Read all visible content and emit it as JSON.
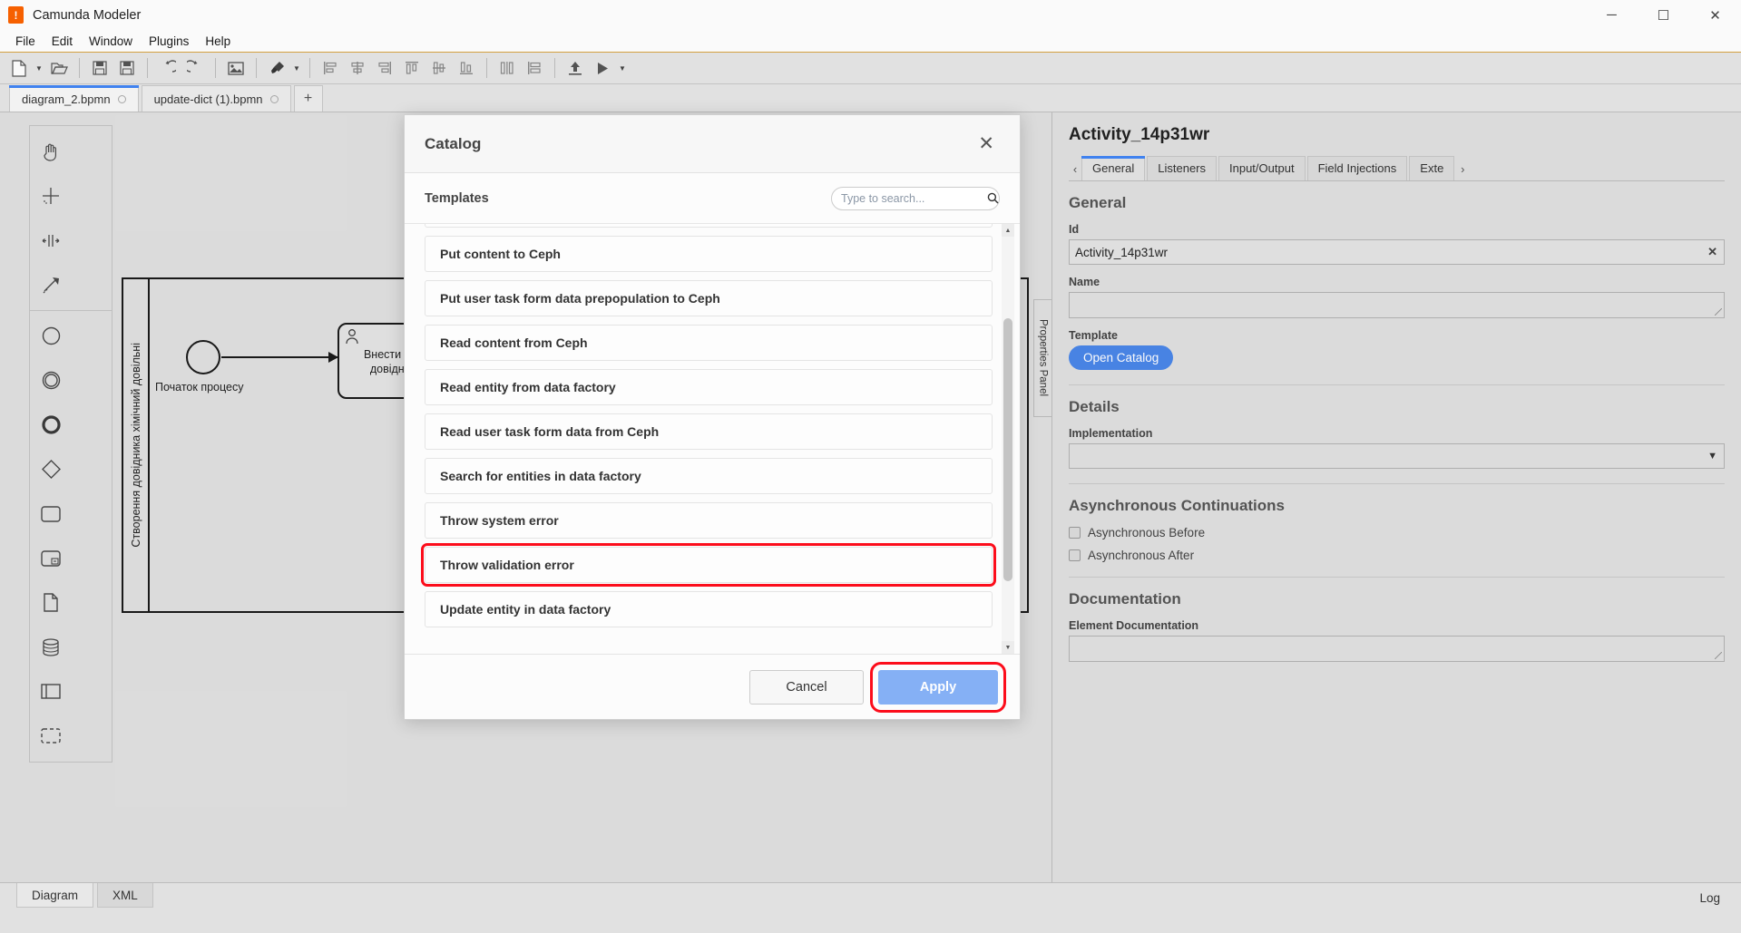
{
  "window": {
    "app_title": "Camunda Modeler",
    "logo_glyph": "!",
    "minimize": "─",
    "maximize": "☐",
    "close": "✕"
  },
  "menu": {
    "items": [
      "File",
      "Edit",
      "Window",
      "Plugins",
      "Help"
    ]
  },
  "toolbar": {
    "buttons": [
      {
        "name": "new-diagram-icon",
        "caret": true
      },
      {
        "name": "open-folder-icon",
        "caret": false
      },
      {
        "name": "save-icon",
        "caret": false
      },
      {
        "name": "save-as-icon",
        "caret": false
      },
      {
        "name": "undo-icon",
        "caret": false
      },
      {
        "name": "redo-icon",
        "caret": false
      },
      {
        "name": "export-image-icon",
        "caret": false
      },
      {
        "name": "align-tool-icon",
        "caret": true
      },
      {
        "name": "align-left-icon",
        "caret": false
      },
      {
        "name": "align-center-icon",
        "caret": false
      },
      {
        "name": "align-right-icon",
        "caret": false
      },
      {
        "name": "align-top-icon",
        "caret": false
      },
      {
        "name": "align-middle-icon",
        "caret": false
      },
      {
        "name": "align-bottom-icon",
        "caret": false
      },
      {
        "name": "distribute-horizontal-icon",
        "caret": false
      },
      {
        "name": "distribute-vertical-icon",
        "caret": false
      },
      {
        "name": "deploy-icon",
        "caret": false
      },
      {
        "name": "start-instance-icon",
        "caret": true
      }
    ]
  },
  "tabs": {
    "items": [
      {
        "label": "diagram_2.bpmn",
        "active": true
      },
      {
        "label": "update-dict (1).bpmn",
        "active": false
      }
    ],
    "add_label": "+"
  },
  "palette": {
    "rows": [
      [
        "hand-tool-icon",
        "lasso-tool-icon"
      ],
      [
        "space-tool-icon",
        "connect-tool-icon"
      ],
      [
        "start-event-icon",
        "intermediate-event-icon"
      ],
      [
        "end-event-icon",
        "gateway-icon"
      ],
      [
        "task-icon",
        "subprocess-icon"
      ],
      [
        "data-object-icon",
        "data-store-icon"
      ],
      [
        "participant-icon",
        "group-icon"
      ]
    ]
  },
  "canvas": {
    "pool_label": "Створення довідника хімічний довільні",
    "start_event_label": "Початок процесу",
    "task_line1": "Внести зап",
    "task_line2": "довідник",
    "properties_panel_tab": "Properties Panel"
  },
  "modal": {
    "title": "Catalog",
    "close_glyph": "✕",
    "section_title": "Templates",
    "search_placeholder": "Type to search...",
    "search_value": "",
    "search_icon": "search-icon",
    "items": [
      {
        "label": "Put content to Ceph",
        "highlighted": false
      },
      {
        "label": "Put user task form data prepopulation to Ceph",
        "highlighted": false
      },
      {
        "label": "Read content from Ceph",
        "highlighted": false
      },
      {
        "label": "Read entity from data factory",
        "highlighted": false
      },
      {
        "label": "Read user task form data from Ceph",
        "highlighted": false
      },
      {
        "label": "Search for entities in data factory",
        "highlighted": false
      },
      {
        "label": "Throw system error",
        "highlighted": false
      },
      {
        "label": "Throw validation error",
        "highlighted": true
      },
      {
        "label": "Update entity in data factory",
        "highlighted": false
      }
    ],
    "scroll_up_glyph": "▲",
    "scroll_down_glyph": "▼",
    "cancel_label": "Cancel",
    "apply_label": "Apply",
    "highlight_color": "#fc0d1b",
    "apply_color": "#85b0f5"
  },
  "properties": {
    "element_title": "Activity_14p31wr",
    "prev_arrow": "‹",
    "next_arrow": "›",
    "tabs": [
      {
        "label": "General",
        "active": true
      },
      {
        "label": "Listeners",
        "active": false
      },
      {
        "label": "Input/Output",
        "active": false
      },
      {
        "label": "Field Injections",
        "active": false
      },
      {
        "label": "Exte",
        "active": false
      }
    ],
    "general_heading": "General",
    "id_label": "Id",
    "id_value": "Activity_14p31wr",
    "id_clear_glyph": "✕",
    "name_label": "Name",
    "name_value": "",
    "template_label": "Template",
    "open_catalog_label": "Open Catalog",
    "details_heading": "Details",
    "implementation_label": "Implementation",
    "implementation_value": "",
    "implementation_caret": "▼",
    "async_heading": "Asynchronous Continuations",
    "async_before_label": "Asynchronous Before",
    "async_after_label": "Asynchronous After",
    "documentation_heading": "Documentation",
    "element_documentation_label": "Element Documentation",
    "element_documentation_value": "",
    "accent_color": "#4285f4",
    "button_color": "#4a86e8"
  },
  "bottom": {
    "tabs": [
      {
        "label": "Diagram",
        "active": false
      },
      {
        "label": "XML",
        "active": true
      }
    ],
    "log_label": "Log"
  }
}
